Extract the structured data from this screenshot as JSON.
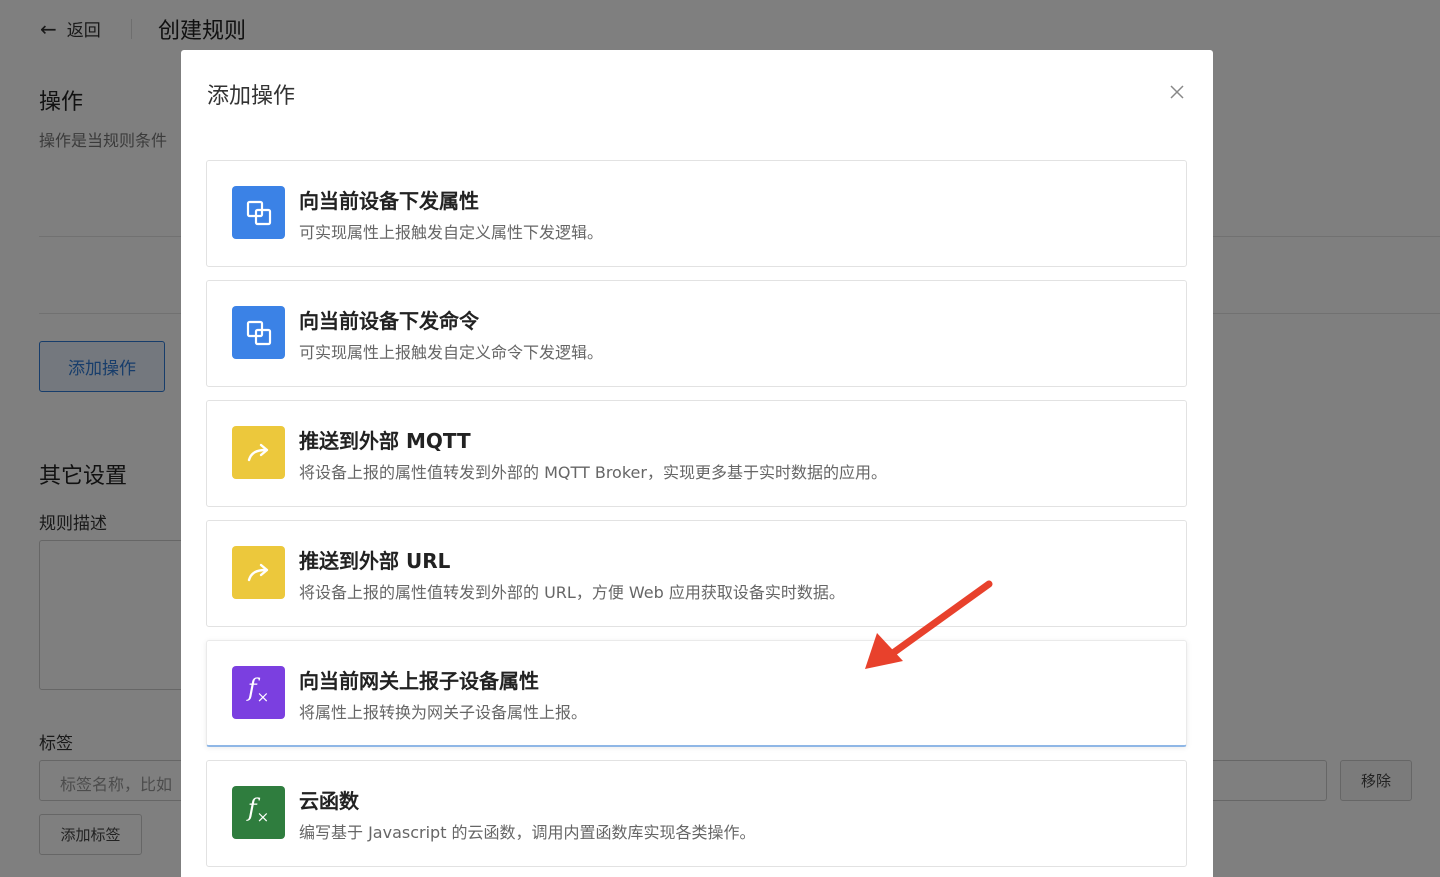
{
  "header": {
    "back_arrow": "←",
    "back_label": "返回",
    "title": "创建规则"
  },
  "operations_section": {
    "title": "操作",
    "description": "操作是当规则条件",
    "add_button_label": "添加操作"
  },
  "other_settings": {
    "title": "其它设置",
    "rule_description_label": "规则描述",
    "tags_label": "标签",
    "tag_input_placeholder": "标签名称，比如",
    "remove_button_label": "移除",
    "add_tag_button_label": "添加标签"
  },
  "modal": {
    "title": "添加操作",
    "close_icon": "close-icon",
    "options": [
      {
        "title": "向当前设备下发属性",
        "description": "可实现属性上报触发自定义属性下发逻辑。",
        "icon": "copy-icon",
        "icon_color": "#3b82e6"
      },
      {
        "title": "向当前设备下发命令",
        "description": "可实现属性上报触发自定义命令下发逻辑。",
        "icon": "copy-icon",
        "icon_color": "#3b82e6"
      },
      {
        "title": "推送到外部 MQTT",
        "description": "将设备上报的属性值转发到外部的 MQTT Broker，实现更多基于实时数据的应用。",
        "icon": "forward-arrow-icon",
        "icon_color": "#ecc83c"
      },
      {
        "title": "推送到外部 URL",
        "description": "将设备上报的属性值转发到外部的 URL，方便 Web 应用获取设备实时数据。",
        "icon": "forward-arrow-icon",
        "icon_color": "#ecc83c"
      },
      {
        "title": "向当前网关上报子设备属性",
        "description": "将属性上报转换为网关子设备属性上报。",
        "icon": "function-fx-icon",
        "icon_color": "#7b3fe0"
      },
      {
        "title": "云函数",
        "description": "编写基于 Javascript 的云函数，调用内置函数库实现各类操作。",
        "icon": "function-fx-icon",
        "icon_color": "#2f7d3e"
      }
    ]
  },
  "annotation": {
    "arrow_color": "#e8412c"
  }
}
